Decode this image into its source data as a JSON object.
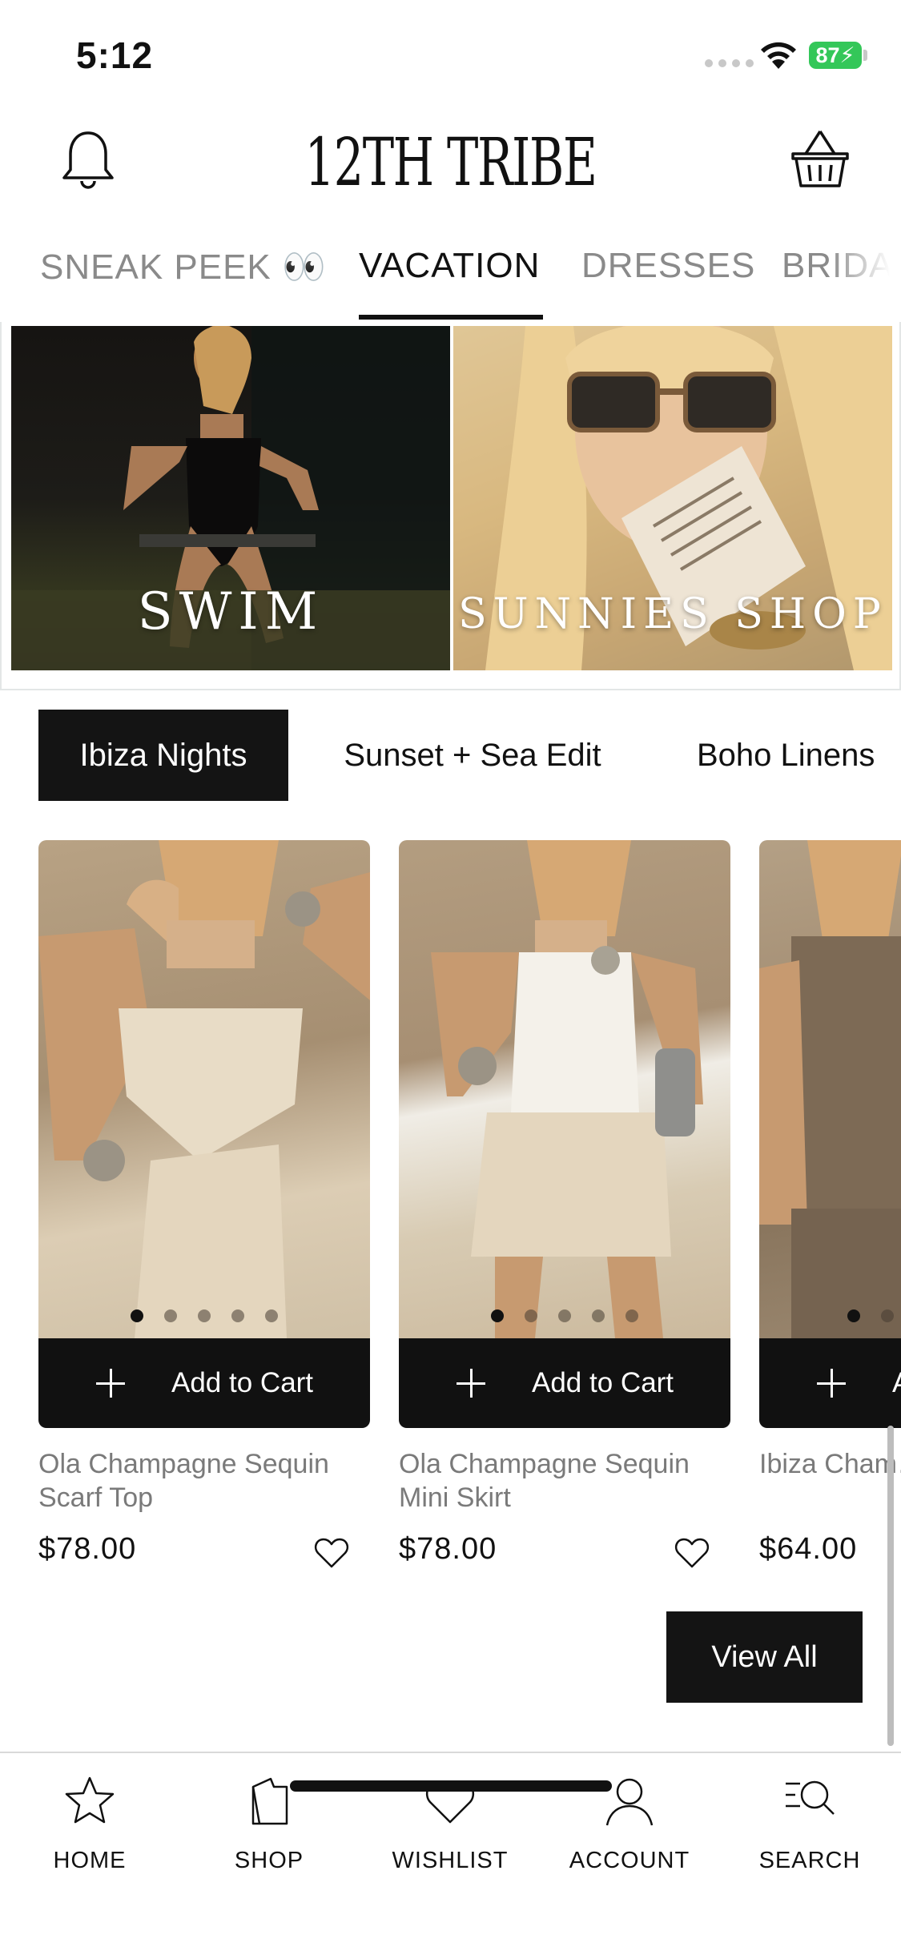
{
  "status_bar": {
    "time": "5:12",
    "battery": "87"
  },
  "header": {
    "logo": "12TH TRIBE",
    "icons": {
      "left": "bell-icon",
      "right": "basket-icon"
    }
  },
  "categories": {
    "tabs": [
      "SNEAK PEEK 👀",
      "VACATION",
      "DRESSES",
      "BRIDA"
    ],
    "active": "VACATION"
  },
  "banners": [
    {
      "label": "SWIM"
    },
    {
      "label": "SUNNIES SHOP"
    }
  ],
  "collections": {
    "pills": [
      "Ibiza Nights",
      "Sunset + Sea Edit",
      "Boho Linens"
    ],
    "active": "Ibiza Nights"
  },
  "products": [
    {
      "name": "Ola Champagne Sequin Scarf Top",
      "price": "$78.00",
      "cta": "Add to Cart"
    },
    {
      "name": "Ola Champagne Sequin Mini Skirt",
      "price": "$78.00",
      "cta": "Add to Cart"
    },
    {
      "name": "Ibiza Cham… Halter Top",
      "price": "$64.00",
      "cta": "Add to Cart"
    }
  ],
  "view_all": "View All",
  "bottom_nav": [
    {
      "label": "HOME",
      "icon": "star-icon"
    },
    {
      "label": "SHOP",
      "icon": "bag-icon"
    },
    {
      "label": "WISHLIST",
      "icon": "heart-icon"
    },
    {
      "label": "ACCOUNT",
      "icon": "user-icon"
    },
    {
      "label": "SEARCH",
      "icon": "search-icon"
    }
  ],
  "colors": {
    "ink": "#111111",
    "muted": "#8a8a8a",
    "battery_green": "#34c759"
  }
}
